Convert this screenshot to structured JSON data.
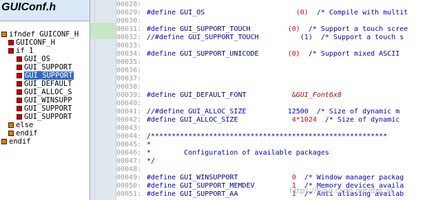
{
  "window": {
    "title": "GUIConf.h"
  },
  "tree": [
    {
      "label": "ifndef GUICONF_H",
      "icon": "define-icon"
    },
    {
      "label": "GUICONF_H",
      "icon": "define-icon"
    },
    {
      "label": "if 1",
      "icon": "define-icon"
    },
    {
      "label": "GUI_OS",
      "icon": "define-icon"
    },
    {
      "label": "GUI_SUPPORT",
      "icon": "define-icon"
    },
    {
      "label": "GUI_SUPPORT",
      "icon": "define-icon",
      "selected": true
    },
    {
      "label": "GUI_DEFAULT",
      "icon": "define-icon"
    },
    {
      "label": "GUI_ALLOC_S",
      "icon": "define-icon"
    },
    {
      "label": "GUI_WINSUPP",
      "icon": "define-icon"
    },
    {
      "label": "GUI_SUPPORT",
      "icon": "define-icon"
    },
    {
      "label": "GUI_SUPPORT",
      "icon": "define-icon"
    },
    {
      "label": "else",
      "icon": "define-icon"
    },
    {
      "label": "endif",
      "icon": "define-icon"
    },
    {
      "label": "endif",
      "icon": "define-icon"
    }
  ],
  "code": [
    {
      "num": "00028:",
      "parts": []
    },
    {
      "num": "00029:",
      "parts": [
        [
          "kw",
          "#define "
        ],
        [
          "mc",
          "GUI_OS"
        ],
        [
          "pad",
          "                      "
        ],
        [
          "num",
          "(0)"
        ],
        [
          "cm",
          "  /* Compile with multit"
        ]
      ]
    },
    {
      "num": "00030:",
      "parts": []
    },
    {
      "num": "00031:",
      "parts": [
        [
          "kw",
          "#define "
        ],
        [
          "mc",
          "GUI_SUPPORT_TOUCH"
        ],
        [
          "pad",
          "         "
        ],
        [
          "num",
          "(0)"
        ],
        [
          "cm",
          "  /* Support a touch scree"
        ]
      ]
    },
    {
      "num": "00032:",
      "parts": [
        [
          "cm",
          "//#define GUI_SUPPORT_TOUCH"
        ],
        [
          "pad",
          "          "
        ],
        [
          "cm",
          "(1)  /* Support a touch s"
        ]
      ]
    },
    {
      "num": "00033:",
      "parts": []
    },
    {
      "num": "00034:",
      "parts": [
        [
          "kw",
          "#define "
        ],
        [
          "mc",
          "GUI_SUPPORT_UNICODE"
        ],
        [
          "pad",
          "       "
        ],
        [
          "num",
          "(0)"
        ],
        [
          "cm",
          "  /* Support mixed ASCII"
        ]
      ]
    },
    {
      "num": "00035:",
      "parts": []
    },
    {
      "num": "00036:",
      "parts": []
    },
    {
      "num": "00037:",
      "parts": []
    },
    {
      "num": "00038:",
      "parts": []
    },
    {
      "num": "00039:",
      "parts": [
        [
          "kw",
          "#define "
        ],
        [
          "mc",
          "GUI_DEFAULT_FONT"
        ],
        [
          "pad",
          "           "
        ],
        [
          "num",
          "&"
        ],
        [
          "fn",
          "GUI_Font6x8"
        ]
      ]
    },
    {
      "num": "00040:",
      "parts": []
    },
    {
      "num": "00041:",
      "parts": [
        [
          "cm",
          "//#define GUI_ALLOC_SIZE"
        ],
        [
          "pad",
          "          "
        ],
        [
          "cm",
          "12500  /* Size of dynamic m"
        ]
      ]
    },
    {
      "num": "00042:",
      "parts": [
        [
          "kw",
          "#define "
        ],
        [
          "mc",
          "GUI_ALLOC_SIZE"
        ],
        [
          "pad",
          "             "
        ],
        [
          "num",
          "4*1024"
        ],
        [
          "cm",
          "  /* Size of dynamic"
        ]
      ]
    },
    {
      "num": "00043:",
      "parts": []
    },
    {
      "num": "00044:",
      "parts": [
        [
          "cm",
          "/*********************************************************"
        ]
      ]
    },
    {
      "num": "00045:",
      "parts": [
        [
          "cm",
          "*"
        ]
      ]
    },
    {
      "num": "00046:",
      "parts": [
        [
          "cm",
          "*        Configuration of available packages"
        ]
      ]
    },
    {
      "num": "00047:",
      "parts": [
        [
          "cm",
          "*/"
        ]
      ]
    },
    {
      "num": "00048:",
      "parts": []
    },
    {
      "num": "00049:",
      "parts": [
        [
          "kw",
          "#define "
        ],
        [
          "mc",
          "GUI_WINSUPPORT"
        ],
        [
          "pad",
          "             "
        ],
        [
          "num",
          "0"
        ],
        [
          "cm",
          "  /* Window manager packag"
        ]
      ]
    },
    {
      "num": "00050:",
      "parts": [
        [
          "kw",
          "#define "
        ],
        [
          "mc",
          "GUI_SUPPORT_MEMDEV"
        ],
        [
          "pad",
          "         "
        ],
        [
          "num",
          "1"
        ],
        [
          "cm",
          "  /* Memory devices availa"
        ]
      ]
    },
    {
      "num": "00051:",
      "parts": [
        [
          "kw",
          "#define "
        ],
        [
          "mc",
          "GUI_SUPPORT_AA"
        ],
        [
          "pad",
          "             "
        ],
        [
          "num",
          "1"
        ],
        [
          "cm",
          "  /* Anti aliasing availab"
        ]
      ]
    }
  ],
  "watermark": "https://blog.csdn.net/dm_sf"
}
